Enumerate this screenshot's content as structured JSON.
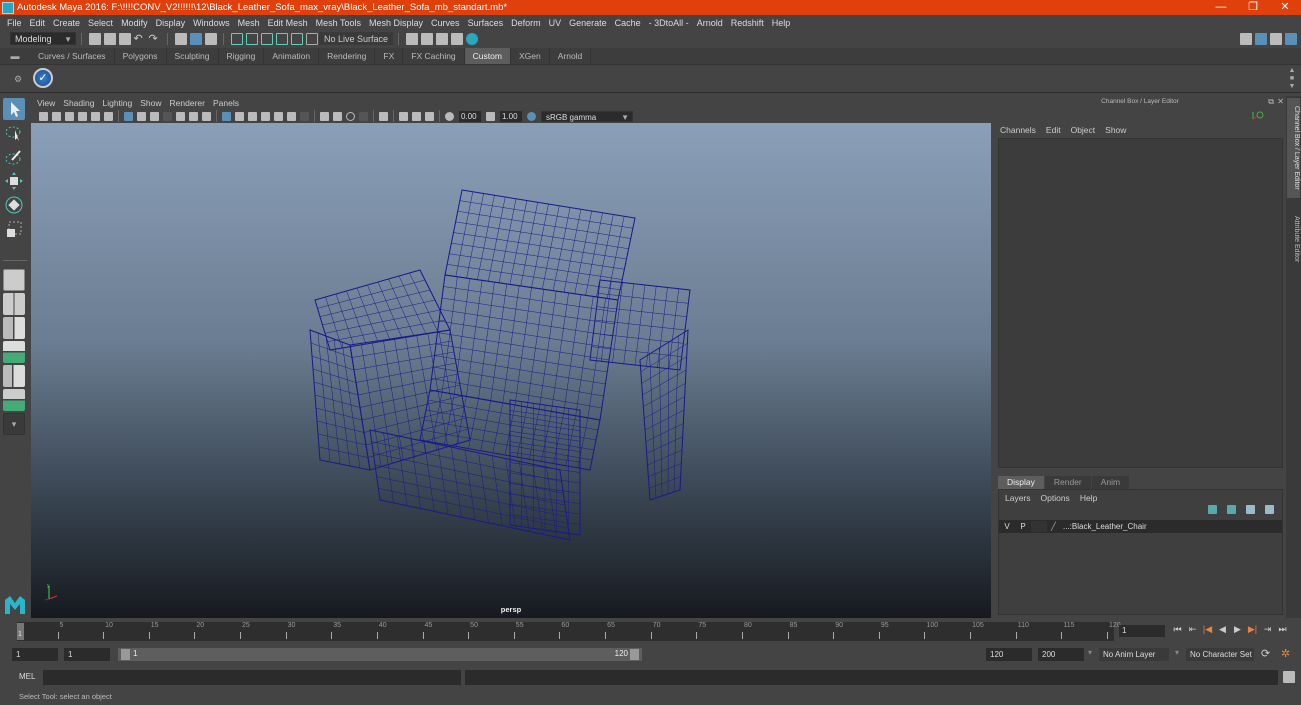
{
  "window": {
    "title": "Autodesk Maya 2016: F:\\!!!!CONV_V2!!!!!!\\12\\Black_Leather_Sofa_max_vray\\Black_Leather_Sofa_mb_standart.mb*",
    "minimize": "—",
    "restore": "❐",
    "close": "✕"
  },
  "menubar": [
    "File",
    "Edit",
    "Create",
    "Select",
    "Modify",
    "Display",
    "Windows",
    "Mesh",
    "Edit Mesh",
    "Mesh Tools",
    "Mesh Display",
    "Curves",
    "Surfaces",
    "Deform",
    "UV",
    "Generate",
    "Cache",
    "- 3DtoAll -",
    "Arnold",
    "Redshift",
    "Help"
  ],
  "statusline": {
    "mode": "Modeling",
    "live_surface": "No Live Surface"
  },
  "shelf": {
    "tabs": [
      "Curves / Surfaces",
      "Polygons",
      "Sculpting",
      "Rigging",
      "Animation",
      "Rendering",
      "FX",
      "FX Caching",
      "Custom",
      "XGen",
      "Arnold"
    ],
    "active_tab": "Custom"
  },
  "viewport": {
    "menu": [
      "View",
      "Shading",
      "Lighting",
      "Show",
      "Renderer",
      "Panels"
    ],
    "exposure": "0.00",
    "gamma": "1.00",
    "color_space": "sRGB gamma",
    "camera_label": "persp",
    "wire_color": "#1a1a8c"
  },
  "channel_box": {
    "header": "Channel Box / Layer Editor",
    "menu": [
      "Channels",
      "Edit",
      "Object",
      "Show"
    ]
  },
  "layer_editor": {
    "tabs": [
      "Display",
      "Render",
      "Anim"
    ],
    "active_tab": "Display",
    "menu": [
      "Layers",
      "Options",
      "Help"
    ],
    "layers": [
      {
        "v": "V",
        "p": "P",
        "name": "...:Black_Leather_Chair"
      }
    ]
  },
  "side_tabs": [
    "Channel Box / Layer Editor",
    "Attribute Editor"
  ],
  "timeline": {
    "ticks": [
      "5",
      "10",
      "15",
      "20",
      "25",
      "30",
      "35",
      "40",
      "45",
      "50",
      "55",
      "60",
      "65",
      "70",
      "75",
      "80",
      "85",
      "90",
      "95",
      "100",
      "105",
      "110",
      "115",
      "120"
    ],
    "start_marker": "1",
    "current_frame": "1"
  },
  "range": {
    "start": "1",
    "playback_start": "1",
    "slider_start": "1",
    "slider_end": "120",
    "playback_end": "120",
    "end": "200",
    "anim_layer": "No Anim Layer",
    "character_set": "No Character Set"
  },
  "command_line": {
    "label": "MEL"
  },
  "status": {
    "help_text": "Select Tool: select an object"
  }
}
